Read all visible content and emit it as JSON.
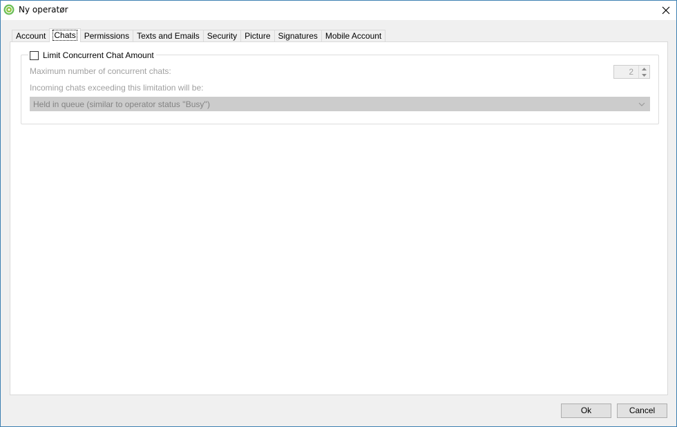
{
  "window": {
    "title": "Ny operatør",
    "close_glyph": "✕"
  },
  "tabs": [
    {
      "label": "Account",
      "active": false
    },
    {
      "label": "Chats",
      "active": true
    },
    {
      "label": "Permissions",
      "active": false
    },
    {
      "label": "Texts and Emails",
      "active": false
    },
    {
      "label": "Security",
      "active": false
    },
    {
      "label": "Picture",
      "active": false
    },
    {
      "label": "Signatures",
      "active": false
    },
    {
      "label": "Mobile Account",
      "active": false
    }
  ],
  "chats": {
    "limit_checkbox_label": "Limit Concurrent Chat Amount",
    "limit_checked": false,
    "max_label": "Maximum number of concurrent chats:",
    "max_value": "2",
    "exceeding_label": "Incoming chats exceeding this limitation will be:",
    "exceeding_selected": "Held in queue (similar to operator status ''Busy'')"
  },
  "footer": {
    "ok_label": "Ok",
    "cancel_label": "Cancel"
  },
  "colors": {
    "accent_border": "#3c7fb1",
    "disabled_text": "#a0a0a0",
    "app_icon": "#5cb85c"
  }
}
